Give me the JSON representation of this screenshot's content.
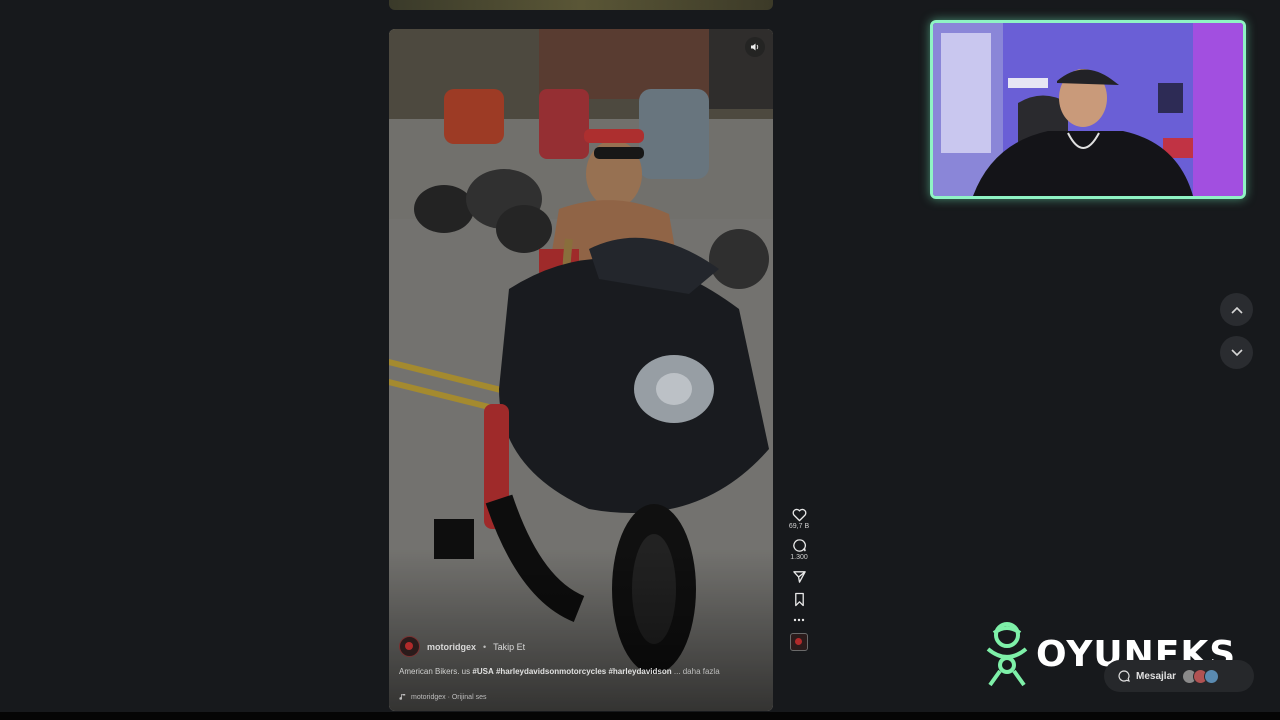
{
  "reel": {
    "author": "motoridgex",
    "separator": "•",
    "follow_label": "Takip Et",
    "caption_text": "American Bikers. us",
    "hashtags": [
      "#USA",
      "#harleydavidsonmotorcycles",
      "#harleydavidson"
    ],
    "more_label": "... daha fazla",
    "audio_label": "motoridgex · Orijinal ses",
    "mute_icon": "speaker-icon"
  },
  "actions": {
    "likes": "69,7 B",
    "comments": "1.300",
    "icons": [
      "heart-icon",
      "comment-icon",
      "share-icon",
      "bookmark-icon",
      "more-icon",
      "audio-avatar-icon"
    ]
  },
  "navigation": {
    "up_icon": "chevron-up-icon",
    "down_icon": "chevron-down-icon"
  },
  "watermark": {
    "brand": "OYUNEKS"
  },
  "messages": {
    "label": "Mesajlar"
  },
  "colors": {
    "page_bg": "#17191c",
    "webcam_border": "#8ff3c4",
    "brand_green": "#7ef0a8",
    "accent_red": "#b12a2a"
  }
}
